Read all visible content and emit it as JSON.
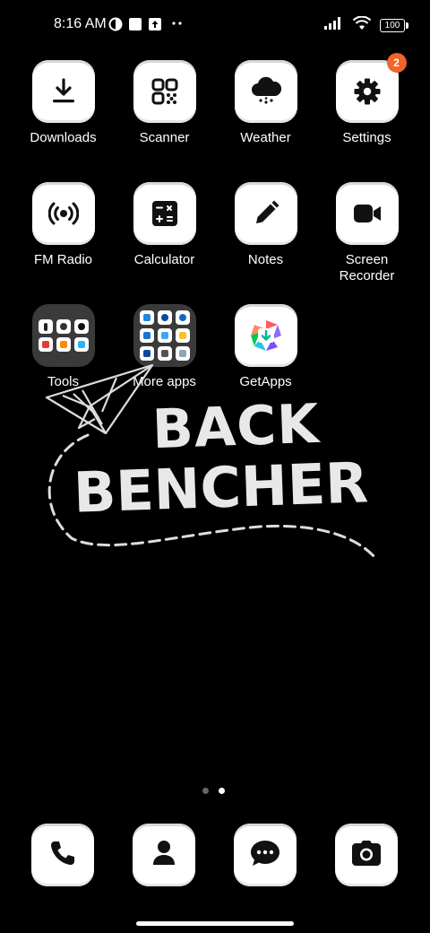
{
  "status_bar": {
    "time": "8:16 AM",
    "battery": "100",
    "icons": [
      "data-saver-icon",
      "gallery-notification-icon",
      "upload-notification-icon",
      "more-notifications-icon",
      "signal-icon",
      "wifi-icon",
      "battery-icon"
    ]
  },
  "apps": [
    {
      "label": "Downloads",
      "icon": "download-icon"
    },
    {
      "label": "Scanner",
      "icon": "qr-scanner-icon"
    },
    {
      "label": "Weather",
      "icon": "cloud-rain-icon"
    },
    {
      "label": "Settings",
      "icon": "gear-icon",
      "badge": "2"
    },
    {
      "label": "FM Radio",
      "icon": "radio-broadcast-icon"
    },
    {
      "label": "Calculator",
      "icon": "calculator-icon"
    },
    {
      "label": "Notes",
      "icon": "pencil-icon"
    },
    {
      "label": "Screen\nRecorder",
      "icon": "video-camera-icon"
    },
    {
      "label": "Tools",
      "icon": "folder-icon"
    },
    {
      "label": "More apps",
      "icon": "folder-icon"
    },
    {
      "label": "GetApps",
      "icon": "getapps-icon"
    }
  ],
  "wallpaper": {
    "line1": "BACK",
    "line2": "BENCHER"
  },
  "pages": {
    "count": 2,
    "active": 2
  },
  "dock": [
    {
      "icon": "phone-icon"
    },
    {
      "icon": "contacts-icon"
    },
    {
      "icon": "messages-icon"
    },
    {
      "icon": "camera-icon"
    }
  ],
  "colors": {
    "background": "#000000",
    "tile": "#ffffff",
    "badge": "#f2642a"
  }
}
